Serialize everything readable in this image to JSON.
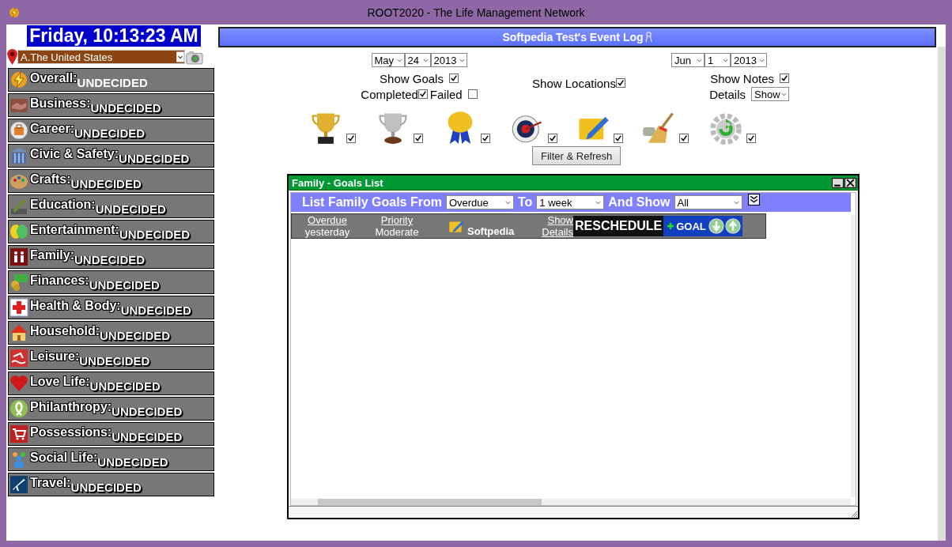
{
  "window": {
    "title": "ROOT2020 - The Life Management Network"
  },
  "clock": "Friday, 10:13:23 AM",
  "location": {
    "value": "A.The United States"
  },
  "categories": [
    {
      "name": "Overall:",
      "status": "UNDECIDED"
    },
    {
      "name": "Business:",
      "status": "UNDECIDED"
    },
    {
      "name": "Career:",
      "status": "UNDECIDED"
    },
    {
      "name": "Civic & Safety:",
      "status": "UNDECIDED"
    },
    {
      "name": "Crafts:",
      "status": "UNDECIDED"
    },
    {
      "name": "Education:",
      "status": "UNDECIDED"
    },
    {
      "name": "Entertainment:",
      "status": "UNDECIDED"
    },
    {
      "name": "Family:",
      "status": "UNDECIDED"
    },
    {
      "name": "Finances:",
      "status": "UNDECIDED"
    },
    {
      "name": "Health & Body:",
      "status": "UNDECIDED"
    },
    {
      "name": "Household:",
      "status": "UNDECIDED"
    },
    {
      "name": "Leisure:",
      "status": "UNDECIDED"
    },
    {
      "name": "Love Life:",
      "status": "UNDECIDED"
    },
    {
      "name": "Philanthropy:",
      "status": "UNDECIDED"
    },
    {
      "name": "Possessions:",
      "status": "UNDECIDED"
    },
    {
      "name": "Social Life:",
      "status": "UNDECIDED"
    },
    {
      "name": "Travel:",
      "status": "UNDECIDED"
    }
  ],
  "event_log": {
    "title": "Softpedia Test's Event Log",
    "from": {
      "month": "May",
      "day": "24",
      "year": "2013"
    },
    "to": {
      "month": "Jun",
      "day": "1",
      "year": "2013"
    },
    "show_goals": {
      "label": "Show Goals",
      "checked": true
    },
    "completed": {
      "label": "Completed",
      "checked": true
    },
    "failed": {
      "label": "Failed",
      "checked": false
    },
    "show_locations": {
      "label": "Show Locations",
      "checked": true
    },
    "show_notes": {
      "label": "Show Notes",
      "checked": true
    },
    "details": {
      "label": "Details",
      "value": "Show"
    },
    "filters": [
      {
        "checked": true
      },
      {
        "checked": true
      },
      {
        "checked": true
      },
      {
        "checked": true
      },
      {
        "checked": true
      },
      {
        "checked": true
      },
      {
        "checked": true
      }
    ],
    "filter_button": "Filter & Refresh"
  },
  "goals_window": {
    "title": "Family - Goals List",
    "filter": {
      "from_label": "List Family Goals From",
      "from": "Overdue",
      "to_label": "To",
      "to": "1 week",
      "show_label": "And Show",
      "show": "All"
    },
    "goal": {
      "due": "Overdue",
      "due_when": "yesterday",
      "priority": "Priority",
      "priority_level": "Moderate",
      "name": "Softpedia",
      "details": "Show Details",
      "reschedule": "RESCHEDULE",
      "add": "GOAL"
    }
  }
}
